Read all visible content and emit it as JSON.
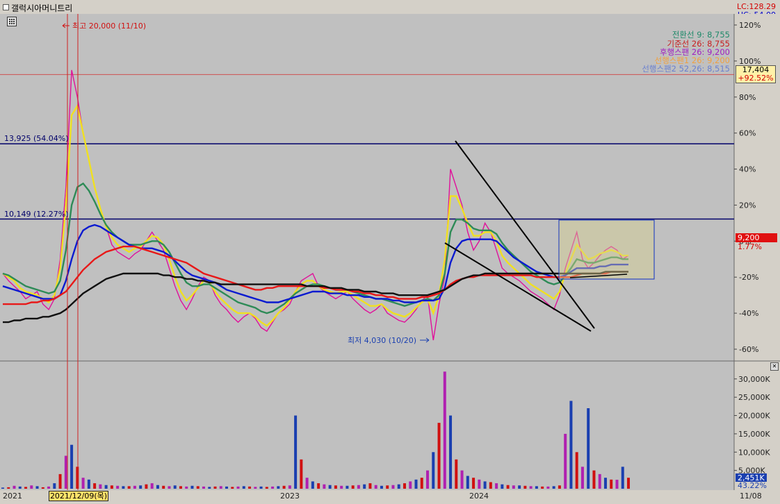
{
  "window": {
    "title": "갤럭시아머니트리",
    "lc": "LC:128.29",
    "hc": "HC:-54.00"
  },
  "legend": [
    {
      "label": "전환선 9: 8,755",
      "color": "#1f8a6a"
    },
    {
      "label": "기준선 26: 8,755",
      "color": "#c81e1e"
    },
    {
      "label": "후행스팬 26: 9,200",
      "color": "#a020c0"
    },
    {
      "label": "선행스팬1 26: 9,200",
      "color": "#f0a040"
    },
    {
      "label": "선행스팬2 52,26: 8,515",
      "color": "#6a80d0"
    }
  ],
  "current_price": {
    "value": "9,200",
    "pct": "1.77%",
    "color": "#e01010"
  },
  "marker_box": {
    "value": "17,404",
    "pct": "+92.52%"
  },
  "annotations": {
    "high": "최고 20,000 (11/10)",
    "low": "최저 4,030 (10/20)",
    "line1": "13,925 (54.04%)",
    "line2": "10,149 (12.27%)"
  },
  "volume_panel": {
    "value": "2,451K",
    "pct": "43.22%"
  },
  "x_labels": [
    "2021",
    "2023",
    "2024",
    "11/08"
  ],
  "date_highlight": "2021/12/09(목)",
  "chart_data": {
    "type": "line",
    "price_axis": {
      "unit": "%",
      "ticks": [
        "120%",
        "100%",
        "80%",
        "60%",
        "40%",
        "20%",
        "0%",
        "-20%",
        "-40%",
        "-60%"
      ],
      "ylim": [
        -60,
        120
      ]
    },
    "volume_axis": {
      "ticks": [
        "30,000K",
        "25,000K",
        "20,000K",
        "15,000K",
        "10,000K",
        "5,000K"
      ],
      "ylim": [
        0,
        33000
      ]
    },
    "horizontal_lines": [
      {
        "label": "13,925 (54.04%)",
        "pct": 54.04,
        "color": "#00006a"
      },
      {
        "label": "10,149 (12.27%)",
        "pct": 12.27,
        "color": "#00006a"
      },
      {
        "label": "",
        "pct": 92.52,
        "color": "#d04040"
      }
    ],
    "series": [
      {
        "name": "후행스팬 26",
        "color": "#e0109a",
        "values": [
          -18,
          -22,
          -25,
          -28,
          -32,
          -30,
          -28,
          -35,
          -38,
          -32,
          -10,
          30,
          95,
          80,
          60,
          45,
          30,
          18,
          8,
          -2,
          -6,
          -8,
          -10,
          -7,
          -5,
          0,
          5,
          0,
          -5,
          -15,
          -25,
          -33,
          -38,
          -32,
          -25,
          -20,
          -22,
          -30,
          -35,
          -38,
          -42,
          -45,
          -42,
          -40,
          -43,
          -48,
          -50,
          -45,
          -40,
          -38,
          -35,
          -28,
          -22,
          -20,
          -18,
          -25,
          -28,
          -30,
          -32,
          -30,
          -28,
          -32,
          -35,
          -38,
          -40,
          -38,
          -35,
          -40,
          -42,
          -44,
          -45,
          -42,
          -38,
          -33,
          -30,
          -55,
          -35,
          -20,
          40,
          30,
          20,
          5,
          -5,
          0,
          10,
          5,
          -5,
          -15,
          -18,
          -20,
          -22,
          -25,
          -28,
          -30,
          -32,
          -35,
          -38,
          -30,
          -15,
          -5,
          5,
          -10,
          -15,
          -12,
          -8,
          -5,
          -3,
          -5,
          -10,
          -8
        ]
      },
      {
        "name": "전환선 9",
        "color": "#f0e020",
        "values": [
          -18,
          -20,
          -22,
          -26,
          -28,
          -29,
          -30,
          -32,
          -34,
          -30,
          -15,
          20,
          70,
          75,
          60,
          45,
          30,
          18,
          8,
          2,
          -2,
          -4,
          -6,
          -4,
          -3,
          0,
          3,
          2,
          -2,
          -10,
          -20,
          -28,
          -33,
          -30,
          -26,
          -22,
          -23,
          -28,
          -32,
          -35,
          -38,
          -40,
          -40,
          -40,
          -42,
          -45,
          -47,
          -44,
          -40,
          -37,
          -33,
          -28,
          -24,
          -22,
          -22,
          -25,
          -27,
          -28,
          -29,
          -28,
          -28,
          -30,
          -32,
          -34,
          -36,
          -36,
          -35,
          -38,
          -40,
          -41,
          -42,
          -40,
          -37,
          -34,
          -32,
          -40,
          -30,
          -10,
          25,
          25,
          18,
          10,
          3,
          3,
          5,
          5,
          0,
          -8,
          -12,
          -15,
          -18,
          -21,
          -24,
          -26,
          -28,
          -30,
          -32,
          -28,
          -18,
          -10,
          -2,
          -6,
          -10,
          -9,
          -7,
          -6,
          -5,
          -6,
          -8,
          -8
        ]
      },
      {
        "name": "기준선 26",
        "color": "#2e8b57",
        "values": [
          -18,
          -19,
          -21,
          -23,
          -25,
          -26,
          -27,
          -28,
          -29,
          -28,
          -22,
          -5,
          20,
          30,
          32,
          28,
          22,
          15,
          9,
          5,
          2,
          0,
          -2,
          -2,
          -2,
          -1,
          0,
          0,
          -2,
          -6,
          -12,
          -18,
          -23,
          -25,
          -25,
          -24,
          -24,
          -26,
          -28,
          -30,
          -32,
          -34,
          -35,
          -36,
          -37,
          -39,
          -40,
          -39,
          -37,
          -35,
          -32,
          -29,
          -27,
          -25,
          -24,
          -24,
          -25,
          -26,
          -27,
          -27,
          -27,
          -28,
          -29,
          -30,
          -31,
          -32,
          -32,
          -33,
          -34,
          -35,
          -36,
          -35,
          -34,
          -33,
          -32,
          -33,
          -30,
          -18,
          5,
          12,
          12,
          10,
          7,
          6,
          6,
          6,
          4,
          -1,
          -5,
          -8,
          -11,
          -14,
          -17,
          -19,
          -21,
          -23,
          -24,
          -23,
          -19,
          -15,
          -10,
          -11,
          -12,
          -12,
          -11,
          -10,
          -9,
          -9,
          -10,
          -10
        ]
      },
      {
        "name": "선행스팬2 52,26",
        "color": "#0a1ad0",
        "values": [
          -25,
          -26,
          -27,
          -28,
          -29,
          -30,
          -31,
          -32,
          -32,
          -32,
          -30,
          -22,
          -10,
          0,
          6,
          8,
          9,
          8,
          6,
          4,
          2,
          0,
          -2,
          -3,
          -4,
          -4,
          -4,
          -5,
          -6,
          -8,
          -11,
          -14,
          -17,
          -19,
          -20,
          -21,
          -22,
          -23,
          -25,
          -27,
          -28,
          -29,
          -30,
          -31,
          -32,
          -33,
          -34,
          -34,
          -34,
          -33,
          -32,
          -31,
          -30,
          -29,
          -28,
          -28,
          -28,
          -29,
          -29,
          -29,
          -30,
          -30,
          -30,
          -31,
          -31,
          -32,
          -32,
          -32,
          -33,
          -33,
          -34,
          -34,
          -34,
          -33,
          -33,
          -33,
          -32,
          -26,
          -12,
          -4,
          0,
          1,
          1,
          1,
          1,
          1,
          0,
          -3,
          -6,
          -9,
          -11,
          -13,
          -15,
          -17,
          -18,
          -19,
          -20,
          -20,
          -19,
          -17,
          -15,
          -15,
          -15,
          -15,
          -14,
          -14,
          -13,
          -13,
          -13,
          -13
        ]
      },
      {
        "name": "선행스팬1 26",
        "color": "#e81818",
        "values": [
          -35,
          -35,
          -35,
          -35,
          -35,
          -34,
          -34,
          -33,
          -33,
          -32,
          -30,
          -28,
          -24,
          -20,
          -16,
          -13,
          -10,
          -8,
          -6,
          -5,
          -4,
          -3,
          -3,
          -3,
          -4,
          -5,
          -6,
          -7,
          -8,
          -9,
          -10,
          -11,
          -12,
          -14,
          -16,
          -18,
          -19,
          -20,
          -21,
          -22,
          -23,
          -24,
          -25,
          -26,
          -27,
          -27,
          -26,
          -26,
          -25,
          -25,
          -25,
          -25,
          -25,
          -25,
          -25,
          -25,
          -26,
          -26,
          -27,
          -27,
          -27,
          -28,
          -28,
          -29,
          -29,
          -30,
          -30,
          -31,
          -31,
          -32,
          -32,
          -32,
          -32,
          -31,
          -31,
          -30,
          -29,
          -27,
          -24,
          -22,
          -21,
          -20,
          -20,
          -19,
          -19,
          -19,
          -19,
          -19,
          -19,
          -19,
          -19,
          -19,
          -19,
          -20,
          -20,
          -20,
          -20,
          -20,
          -20,
          -20,
          -19,
          -18,
          -18,
          -18,
          -18,
          -18,
          -17,
          -17,
          -17,
          -17
        ]
      },
      {
        "name": "",
        "color": "#101010",
        "values": [
          -45,
          -45,
          -44,
          -44,
          -43,
          -43,
          -43,
          -42,
          -42,
          -41,
          -40,
          -38,
          -35,
          -32,
          -29,
          -27,
          -25,
          -23,
          -21,
          -20,
          -19,
          -18,
          -18,
          -18,
          -18,
          -18,
          -18,
          -18,
          -19,
          -19,
          -20,
          -20,
          -21,
          -21,
          -22,
          -22,
          -23,
          -23,
          -24,
          -24,
          -24,
          -24,
          -24,
          -24,
          -24,
          -24,
          -24,
          -24,
          -24,
          -24,
          -24,
          -24,
          -24,
          -25,
          -25,
          -25,
          -25,
          -26,
          -26,
          -26,
          -27,
          -27,
          -27,
          -28,
          -28,
          -28,
          -29,
          -29,
          -29,
          -30,
          -30,
          -30,
          -30,
          -30,
          -30,
          -29,
          -28,
          -27,
          -25,
          -23,
          -21,
          -20,
          -19,
          -19,
          -18,
          -18,
          -18,
          -18,
          -18,
          -18,
          -18,
          -18,
          -18,
          -18,
          -18,
          -18,
          -18,
          -18,
          -18,
          -18,
          -18,
          -18,
          -18,
          -18,
          -18,
          -17,
          -17,
          -17,
          -17,
          -17
        ]
      }
    ],
    "volume": [
      300,
      400,
      800,
      600,
      500,
      900,
      700,
      400,
      600,
      1500,
      4000,
      9000,
      12000,
      6000,
      3000,
      2500,
      1500,
      1200,
      1000,
      900,
      800,
      700,
      700,
      800,
      900,
      1200,
      1500,
      1000,
      800,
      700,
      900,
      700,
      600,
      800,
      700,
      600,
      500,
      600,
      700,
      600,
      500,
      600,
      700,
      600,
      500,
      600,
      500,
      600,
      700,
      800,
      900,
      20000,
      8000,
      3000,
      2000,
      1500,
      1200,
      1000,
      900,
      800,
      800,
      900,
      1000,
      1200,
      1500,
      1000,
      800,
      900,
      1000,
      1200,
      1500,
      2000,
      2500,
      3000,
      5000,
      10000,
      18000,
      32000,
      20000,
      8000,
      5000,
      3500,
      3000,
      2500,
      2000,
      1800,
      1500,
      1200,
      1000,
      900,
      900,
      800,
      700,
      700,
      600,
      600,
      700,
      900,
      15000,
      24000,
      10000,
      6000,
      22000,
      5000,
      4000,
      3000,
      2500,
      2451,
      6000,
      3000
    ]
  }
}
